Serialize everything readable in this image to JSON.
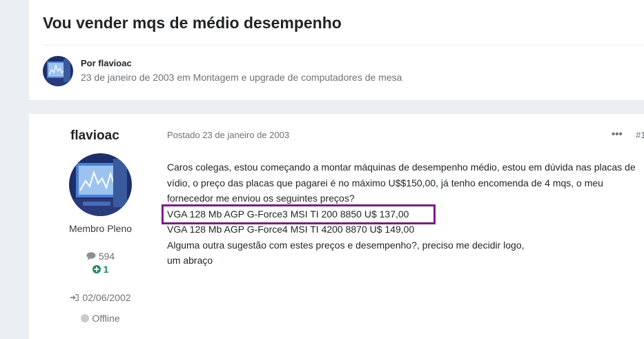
{
  "topic": {
    "title": "Vou vender mqs de médio desempenho",
    "byline": "Por flavioac",
    "meta": "23 de janeiro de 2003 em Montagem e upgrade de computadores de mesa"
  },
  "author": {
    "username": "flavioac",
    "rank": "Membro Pleno",
    "posts": "594",
    "reputation": "1",
    "joined": "02/06/2002",
    "status": "Offline"
  },
  "post": {
    "date": "Postado 23 de janeiro de 2003",
    "menu_label": "•••",
    "number": "#1",
    "paragraph": "Caros colegas, estou começando a montar máquinas de desempenho médio, estou em dúvida nas placas de vídio, o preço das placas  que pagarei é no máximo U$$150,00, já tenho encomenda de 4 mqs, o meu fornecedor me enviou os seguintes preços?",
    "line_1": "VGA 128 Mb AGP G-Force3 MSI TI 200 8850 U$ 137,00",
    "line_2": "VGA 128 Mb AGP G-Force4 MSI TI 4200 8870 U$  149,00",
    "line_3": "Alguma outra sugestão com estes preços e desempenho?, preciso me decidir logo,",
    "line_4": "um abraço"
  },
  "colors": {
    "highlight_border": "#7a1d86",
    "reputation_green": "#1a8b5a",
    "status_dot": "#c8ccd0"
  },
  "icons": [
    "avatar-image",
    "speech-bubble-icon",
    "plus-circle-icon",
    "sign-in-icon",
    "offline-dot-icon"
  ]
}
